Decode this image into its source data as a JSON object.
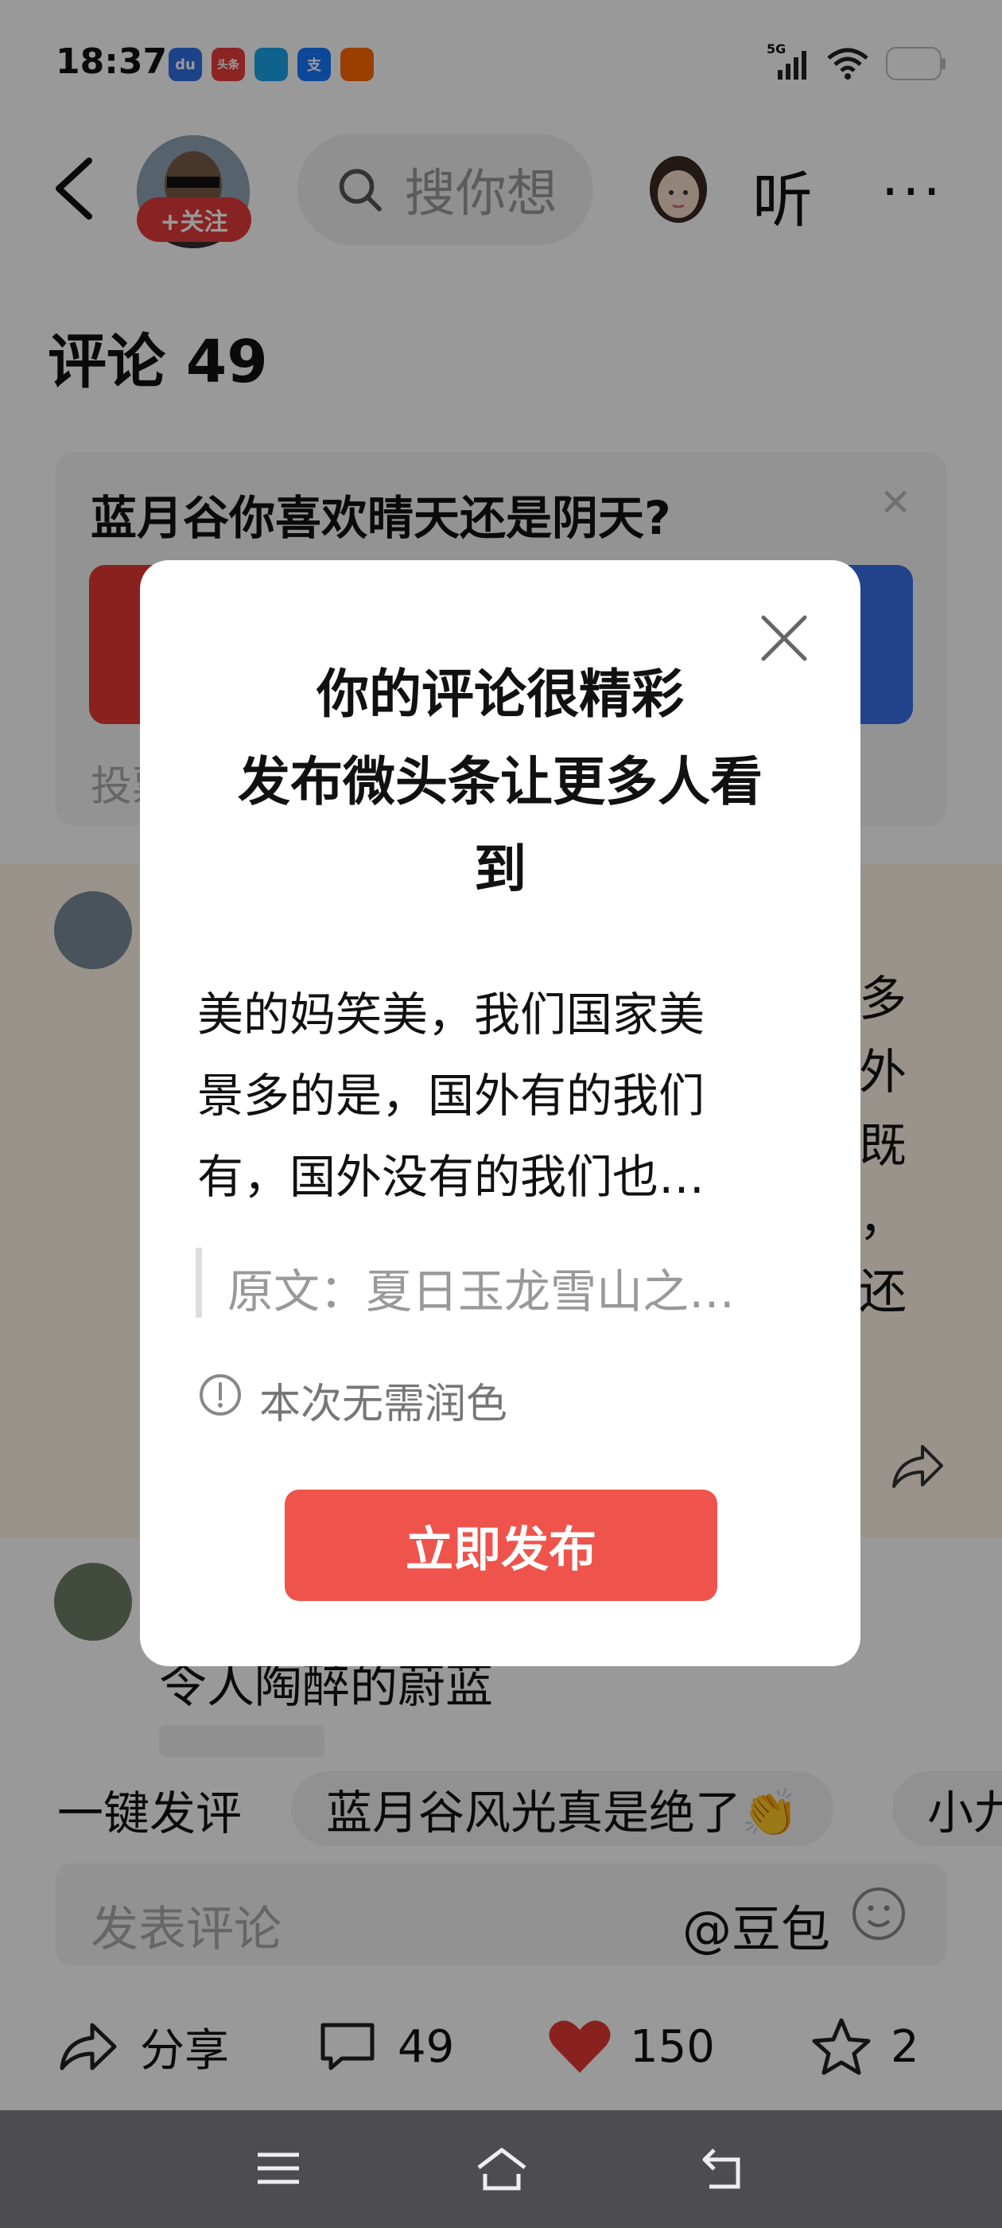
{
  "status_bar": {
    "time": "18:37",
    "notification_icons": [
      {
        "name": "baidu-icon",
        "label": "du",
        "color": "#2f6fe4"
      },
      {
        "name": "toutiao-icon",
        "label": "头条",
        "color": "#e93c3c"
      },
      {
        "name": "app-blue-icon",
        "label": "",
        "color": "#1aa3e8"
      },
      {
        "name": "alipay-icon",
        "label": "支",
        "color": "#1677ff"
      },
      {
        "name": "app-orange-icon",
        "label": "",
        "color": "#ff6a00"
      }
    ],
    "network": "5G"
  },
  "header": {
    "follow_label": "+关注",
    "search_placeholder": "搜你想",
    "listen_label": "听",
    "more_label": "···"
  },
  "comments": {
    "title": "评论 49"
  },
  "poll": {
    "question": "蓝月谷你喜欢晴天还是阴天?",
    "footer": "投票"
  },
  "comment1": {
    "visible_text": [
      "多",
      "外",
      "既",
      "，",
      "还"
    ]
  },
  "comment2": {
    "visible_text": "令人陶醉的蔚蓝"
  },
  "quick_reply": {
    "label": "一键发评",
    "chips": [
      "蓝月谷风光真是绝了👏",
      "小九"
    ]
  },
  "comment_input": {
    "placeholder": "发表评论",
    "mention": "@豆包"
  },
  "action_bar": {
    "share_label": "分享",
    "comment_count": "49",
    "like_count": "150",
    "favorite_count": "2"
  },
  "dialog": {
    "title_lines": [
      "你的评论很精彩",
      "发布微头条让更多人看",
      "到"
    ],
    "body_lines": [
      "美的妈笑美，我们国家美",
      "景多的是，国外有的我们",
      "有，国外没有的我们也…"
    ],
    "quote": "原文：夏日玉龙雪山之…",
    "notice": "本次无需润色",
    "publish_button": "立即发布"
  },
  "colors": {
    "accent_red": "#ee544b",
    "follow_red": "#e33b3b",
    "like_red": "#e53935"
  }
}
